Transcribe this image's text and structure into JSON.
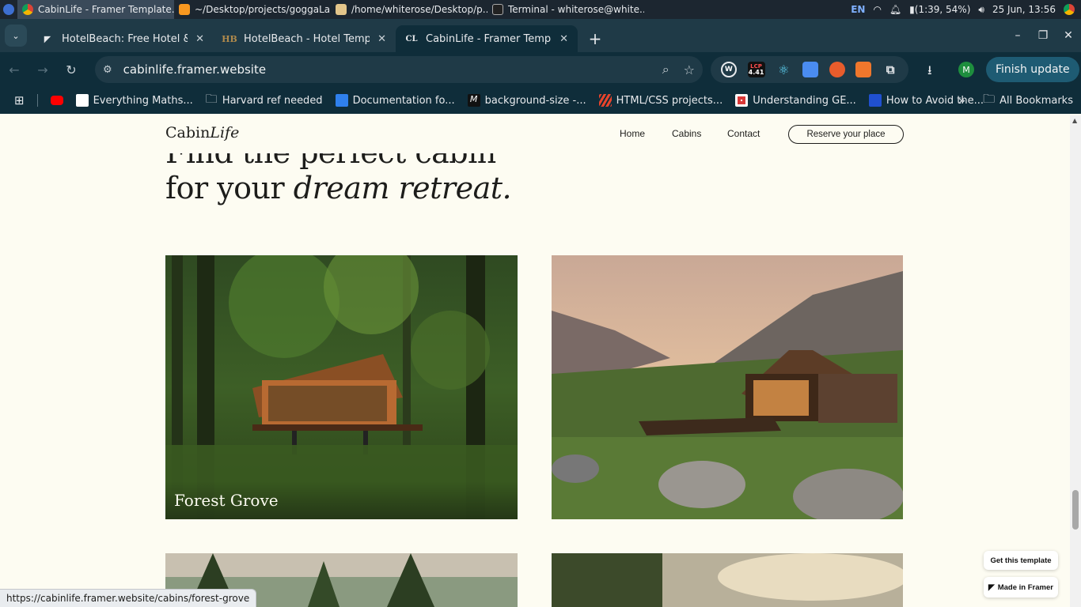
{
  "os_bar": {
    "windows": [
      {
        "title": "CabinLife - Framer Template...",
        "active": true
      },
      {
        "title": "~/Desktop/projects/goggaLa..."
      },
      {
        "title": "/home/whiterose/Desktop/p..."
      },
      {
        "title": "Terminal - whiterose@white..."
      }
    ],
    "lang": "EN",
    "battery": "(1:39, 54%)",
    "datetime": "25 Jun, 13:56"
  },
  "tabs": [
    {
      "favicon": "framer-icon",
      "title": "HotelBeach: Free Hotel & Ren"
    },
    {
      "favicon": "HB",
      "title": "HotelBeach - Hotel Template"
    },
    {
      "favicon": "CL",
      "title": "CabinLife - Framer Template",
      "active": true
    }
  ],
  "toolbar": {
    "url": "cabinlife.framer.website",
    "finish_update_label": "Finish update",
    "profile_initial": "M",
    "lcp_badge_top": "LCP",
    "lcp_badge_value": "4.41"
  },
  "bookmarks": [
    {
      "icon": "youtube-icon",
      "label": ""
    },
    {
      "icon": "page-icon",
      "label": "Everything Maths..."
    },
    {
      "icon": "folder-icon",
      "label": "Harvard ref needed"
    },
    {
      "icon": "vscode-icon",
      "label": "Documentation fo..."
    },
    {
      "icon": "m-icon",
      "label": "background-size -..."
    },
    {
      "icon": "stripes-icon",
      "label": "HTML/CSS projects..."
    },
    {
      "icon": "gem-icon",
      "label": "Understanding GE..."
    },
    {
      "icon": "block-icon",
      "label": "How to Avoid the..."
    }
  ],
  "bookmarks_all_label": "All Bookmarks",
  "site": {
    "logo_main": "Cabin",
    "logo_italic": "Life",
    "nav": [
      "Home",
      "Cabins",
      "Contact"
    ],
    "reserve_label": "Reserve your place",
    "hero_line1": "Find the perfect cabin",
    "hero_line2_plain": "for your ",
    "hero_line2_italic": "dream retreat.",
    "cards": [
      {
        "label": "Forest Grove"
      },
      {
        "label": ""
      }
    ],
    "get_template_label": "Get this template",
    "made_in_framer_label": "Made in Framer"
  },
  "status_url": "https://cabinlife.framer.website/cabins/forest-grove"
}
